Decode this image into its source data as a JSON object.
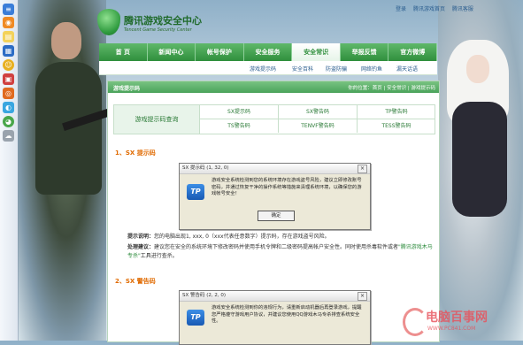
{
  "top_links": [
    "登录",
    "腾讯游戏首页",
    "腾讯客服"
  ],
  "logo": {
    "title": "腾讯游戏安全中心",
    "subtitle": "Tencent Game Security Center"
  },
  "nav": [
    "首 页",
    "新闻中心",
    "帐号保护",
    "安全服务",
    "安全常识",
    "举报反馈",
    "官方微博"
  ],
  "nav_active_index": 4,
  "subnav": [
    "游戏提示码",
    "安全百科",
    "防盗防骗",
    "网络钓鱼",
    "漏天话语"
  ],
  "panel": {
    "title": "游戏提示码",
    "breadcrumb": "你的位置：首页 | 安全常识 | 游戏提示码"
  },
  "query": {
    "label": "游戏提示码查询",
    "codes": [
      "SX提示码",
      "SX警告码",
      "TP警告码",
      "TS警告码",
      "TENVF警告码",
      "TESS警告码"
    ]
  },
  "section1": {
    "title": "1、SX 提示码",
    "dialog": {
      "title": "SX 提示码 (1, 32, 0)",
      "close": "×",
      "logo": "TP",
      "message": "游戏安全系统检测到您的系统环境存在游戏盗号风险，建议立即修改账号密码，并通过恢复干净的操作系统等措施来清理系统环境，以确保您的游戏帐号安全！",
      "ok": "确定"
    },
    "tip_label": "提示说明：",
    "tip_text": "您的电脑出现1, xxx, 0（xxx代表任意数字）提示码，存在游戏盗号风险。",
    "advice_label": "处理建议：",
    "advice_text": "建议您在安全的系统环境下修改密码并使用手机令牌和二级密码提高帐户安全性。同时使用杀毒软件或者",
    "advice_link": "\"腾讯游戏木马专杀\"",
    "advice_tail": "工具进行查杀。"
  },
  "section2": {
    "title": "2、SX 警告码",
    "dialog": {
      "title": "SX 警告码 (2, 2, 0)",
      "close": "×",
      "logo": "TP",
      "message": "游戏安全系统检测到你的违规行为，请重新启动机器后再登录游戏，提醒您严格遵守游戏用户协议，并建议您使用QQ游戏木马专杀排查系统安全性。"
    }
  },
  "watermark": {
    "title": "电脑百事网",
    "url": "WWW.PC841.COM"
  }
}
